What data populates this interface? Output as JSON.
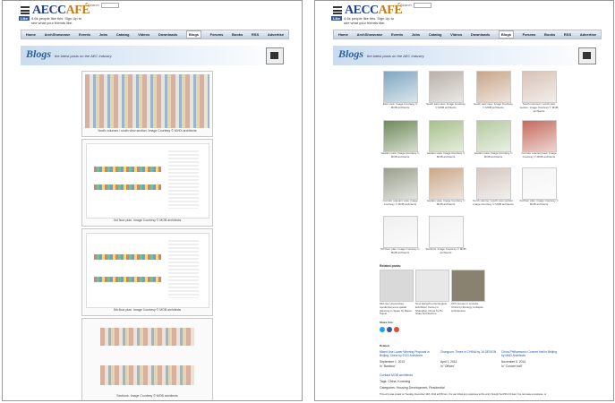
{
  "site": {
    "logo_main": "AECC",
    "logo_accent": "AFÉ",
    "search_label": "Search",
    "fb_like": "Like",
    "fb_text_1": "4.6k people like this. Sign Up to",
    "fb_text_2": "see what your friends like."
  },
  "nav": [
    "Home",
    "ArchShowcase",
    "Events",
    "Jobs",
    "Catalog",
    "Videos",
    "Downloads",
    "Blogs",
    "Forums",
    "Books",
    "RSS",
    "Advertise"
  ],
  "nav_active": "Blogs",
  "banner": {
    "title": "Blogs",
    "tagline": "the latest posts on the AEC Industry"
  },
  "left": {
    "captions": [
      "North volumes / south view section. Image Courtesy © MVDI architects",
      "3rd floor plan. Image Courtesy © MOB architects",
      "5th floor plan. Image Courtesy © MOB architects",
      "Sections. Image Courtesy © MOB architects"
    ]
  },
  "right": {
    "thumb_captions": [
      "East view. Image Courtesy © MOB architects",
      "South east view. Image Courtesy © MOB architects",
      "South east view. Image Courtesy © MOB architects",
      "South volumes / south view section. Image Courtesy © MOB architects",
      "Garden view. Image Courtesy © MOB architects",
      "Garden view. Image Courtesy © MOB architects",
      "Garden view. Image Courtesy © MOB architects",
      "Corridor relevant view. Image Courtesy © MOB architects",
      "Corridor relevant view. Image Courtesy © MOB architects",
      "Garden view. Image Courtesy © MOB architects",
      "North volume / south view section. Image Courtesy © MOB architects",
      "3rd floor plan. Image Courtesy © MOB architects",
      "5th floor plan. Image Courtesy © MOB architects",
      "Sections. Image Courtesy © MOB architects"
    ],
    "related_title": "Related posts:",
    "related": [
      "Mid-rise Universities residential area spatial planning in Spain by Maver Squat",
      "New Hangzhou Ecological Exhibition Center in Shanghai, China by Pu Shao Architecture",
      "CPC House in Linsolia, China by Ecology Collapse Architecture"
    ],
    "share_title": "Share this:",
    "related2_title": "Related",
    "posts": [
      {
        "title": "Mixed Use Lower Winning Proposal in Beijing, China by ECG Architects",
        "date": "September 1, 2013",
        "cat": "In \"Bamboo\""
      },
      {
        "title": "Zhongcun: Times in CHINA by 16 DESIGN",
        "date": "April 1, 2014",
        "cat": "In \"Offices\""
      },
      {
        "title": "China Philharmonic Concert Hall in Beijing by MAD Architects",
        "date": "November 6, 2014",
        "cat": "In \"Concert hall\""
      }
    ],
    "contact": "Contact MOB architects",
    "tags": "Tags: China, Kunming",
    "categories": "Categories: Housing Development, Residential",
    "footer": "This entry was posted on Tuesday, December 10th, 2014 at 8:50 am. You can follow any responses to this entry through the RSS 2.0 feed. You can leave a response, or"
  }
}
